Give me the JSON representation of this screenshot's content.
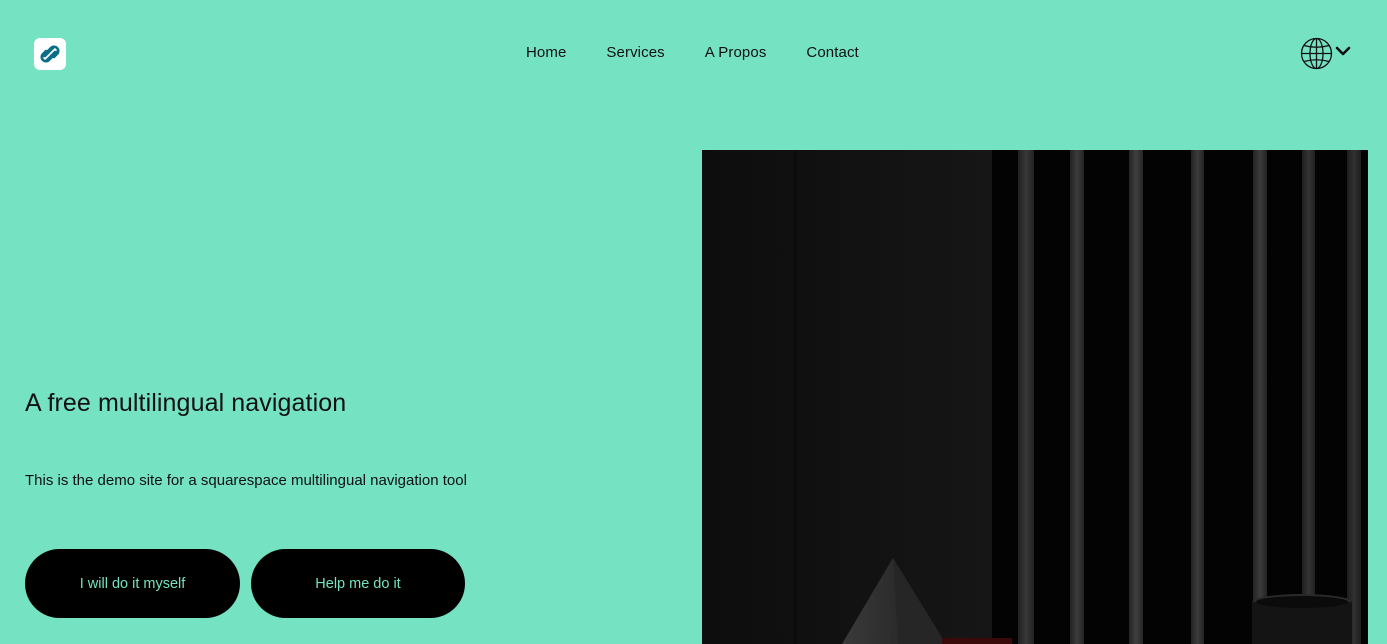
{
  "header": {
    "logo_icon": "squarespace-logo-icon",
    "nav": {
      "home": "Home",
      "services": "Services",
      "apropos": "A Propos",
      "contact": "Contact"
    },
    "language_icon": "globe-icon",
    "language_chevron": "chevron-down-icon"
  },
  "hero": {
    "title": "A free multilingual navigation",
    "subtitle": "This is the demo site for a squarespace multilingual navigation tool",
    "buttons": {
      "self": "I will do it myself",
      "help": "Help me do it"
    },
    "image_alt": "Dark still life with a pyramid, cup and vertical wooden slats"
  },
  "colors": {
    "background": "#75e2c1",
    "button_bg": "#000000",
    "button_text": "#75e2c1"
  }
}
